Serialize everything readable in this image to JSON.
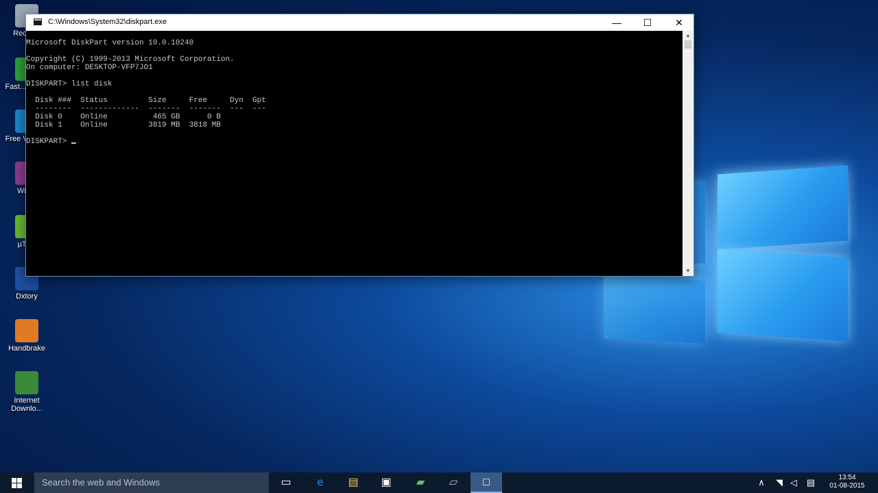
{
  "desktop": {
    "icons": [
      {
        "label": "Recyc...",
        "icon": "recycle-bin-icon",
        "color": "#9aa7b5"
      },
      {
        "label": "Fast... Cap...",
        "icon": "faststone-capture-icon",
        "color": "#2e9e3c"
      },
      {
        "label": "Free Video...",
        "icon": "free-video-icon",
        "color": "#1d86c9"
      },
      {
        "label": "Win...",
        "icon": "winrar-icon",
        "color": "#8a3b8f"
      },
      {
        "label": "µTo...",
        "icon": "utorrent-icon",
        "color": "#69b92d"
      },
      {
        "label": "Dxtory",
        "icon": "dxtory-icon",
        "color": "#1e4fa0"
      },
      {
        "label": "Handbrake",
        "icon": "handbrake-icon",
        "color": "#e07a24"
      },
      {
        "label": "Internet Downlo...",
        "icon": "internet-download-manager-icon",
        "color": "#3a8a3a"
      }
    ]
  },
  "console": {
    "title": "C:\\Windows\\System32\\diskpart.exe",
    "minimize": "—",
    "maximize": "☐",
    "close": "✕",
    "lines": [
      "Microsoft DiskPart version 10.0.10240",
      "",
      "Copyright (C) 1999-2013 Microsoft Corporation.",
      "On computer: DESKTOP-VFP7JO1",
      "",
      "DISKPART> list disk",
      "",
      "  Disk ###  Status         Size     Free     Dyn  Gpt",
      "  --------  -------------  -------  -------  ---  ---",
      "  Disk 0    Online          465 GB      0 B",
      "  Disk 1    Online         3819 MB  3818 MB",
      ""
    ],
    "prompt": "DISKPART> "
  },
  "taskbar": {
    "search_placeholder": "Search the web and Windows",
    "apps": [
      {
        "name": "task-view",
        "glyph": "▭"
      },
      {
        "name": "edge",
        "glyph": "e",
        "color": "#2f8ee0"
      },
      {
        "name": "file-explorer",
        "glyph": "▤",
        "color": "#f2c54a"
      },
      {
        "name": "store",
        "glyph": "▣"
      },
      {
        "name": "app-green",
        "glyph": "▰",
        "color": "#5fc46a"
      },
      {
        "name": "app-gray",
        "glyph": "▱",
        "color": "#c0c0c0"
      },
      {
        "name": "diskpart-console",
        "glyph": "□"
      }
    ],
    "tray": {
      "chevron": "∧",
      "network": "◥",
      "volume": "◁",
      "notifications": "▤"
    },
    "time": "13:54",
    "date": "01-08-2015"
  }
}
